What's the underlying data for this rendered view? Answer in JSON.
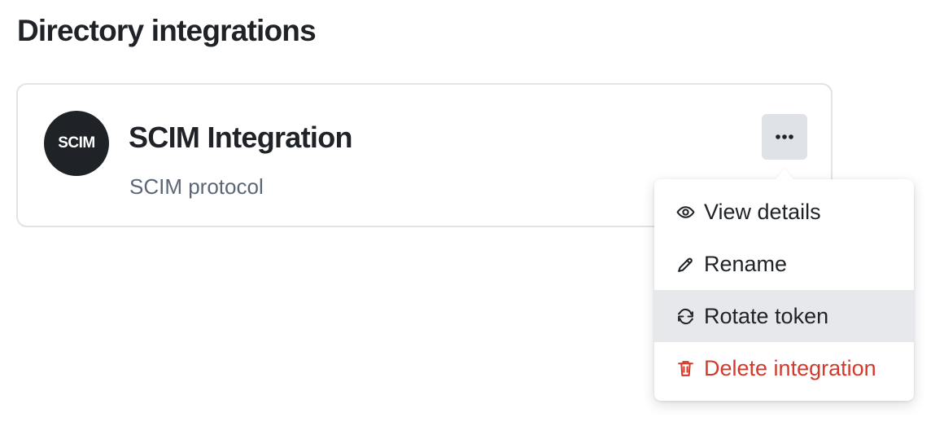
{
  "page": {
    "title": "Directory integrations"
  },
  "integration": {
    "logo_text": "SCIM",
    "name": "SCIM Integration",
    "subtitle": "SCIM protocol",
    "more_button_label": "···"
  },
  "menu": {
    "items": [
      {
        "label": "View details",
        "icon": "eye-icon",
        "state": "default"
      },
      {
        "label": "Rename",
        "icon": "pencil-icon",
        "state": "default"
      },
      {
        "label": "Rotate token",
        "icon": "refresh-icon",
        "state": "hovered"
      },
      {
        "label": "Delete integration",
        "icon": "trash-icon",
        "state": "danger"
      }
    ]
  },
  "colors": {
    "text_primary": "#1f2328",
    "text_secondary": "#5b6778",
    "border": "#dfe4e8",
    "button_background": "#dfe3e8",
    "hover_background": "#e6e8eb",
    "danger": "#d33a2c"
  }
}
